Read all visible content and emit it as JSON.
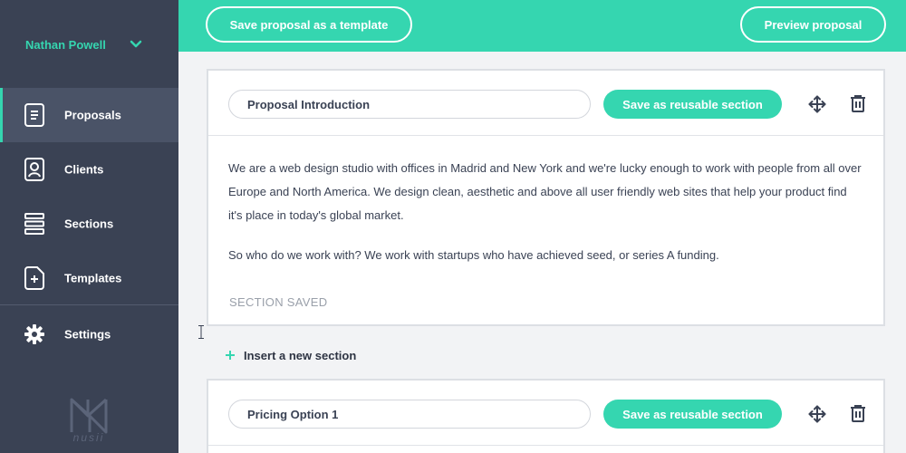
{
  "user": {
    "name": "Nathan Powell",
    "menu_icon": "chevron-down-icon"
  },
  "nav": {
    "items": [
      {
        "label": "Proposals",
        "icon": "document-icon",
        "active": true
      },
      {
        "label": "Clients",
        "icon": "client-icon",
        "active": false
      },
      {
        "label": "Sections",
        "icon": "sections-icon",
        "active": false
      },
      {
        "label": "Templates",
        "icon": "template-add-icon",
        "active": false
      }
    ],
    "settings": {
      "label": "Settings",
      "icon": "gear-icon"
    }
  },
  "brand": {
    "logo_text": "nusii"
  },
  "toolbar": {
    "save_template_label": "Save proposal as a template",
    "preview_label": "Preview proposal"
  },
  "sections": [
    {
      "title": "Proposal Introduction",
      "reuse_label": "Save as reusable section",
      "paragraphs": [
        "We are a web design studio with offices in Madrid and New York and we're lucky enough to work with people from all over Europe and North America. We design clean, aesthetic and above all user friendly web sites that help your product find it's place in today's global market.",
        "So who do we work with? We work with startups who have achieved seed, or series A funding."
      ],
      "status": "SECTION SAVED"
    },
    {
      "title": "Pricing Option 1",
      "reuse_label": "Save as reusable section"
    }
  ],
  "insert_section_label": "Insert a new section",
  "colors": {
    "accent": "#35d6b0",
    "sidebar": "#3a4254",
    "sidebar_active": "#4a5367"
  }
}
